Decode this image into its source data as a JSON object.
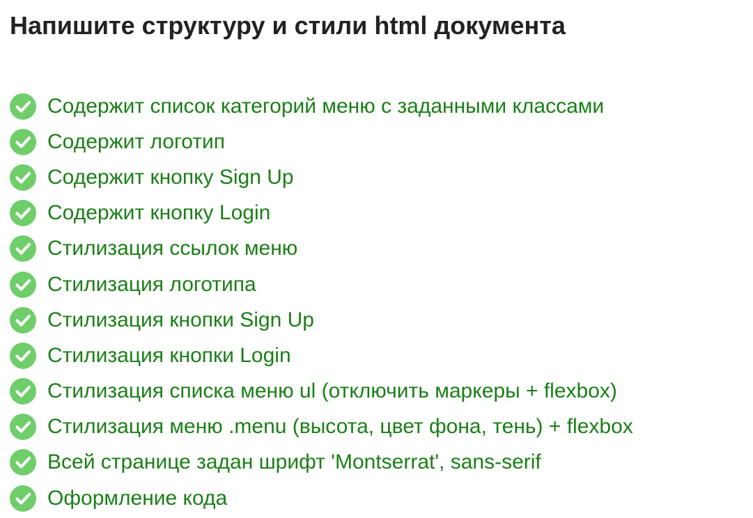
{
  "page": {
    "title": "Напишите структуру и стили html документа"
  },
  "checklist": {
    "icon": "check-circle-icon",
    "icon_color": "#6fce6a",
    "text_color": "#1a7f16",
    "items": [
      {
        "label": "Содержит список категорий меню с заданными классами",
        "checked": true
      },
      {
        "label": "Содержит логотип",
        "checked": true
      },
      {
        "label": "Содержит кнопку Sign Up",
        "checked": true
      },
      {
        "label": "Содержит кнопку Login",
        "checked": true
      },
      {
        "label": "Стилизация ссылок меню",
        "checked": true
      },
      {
        "label": "Стилизация логотипа",
        "checked": true
      },
      {
        "label": "Стилизация кнопки Sign Up",
        "checked": true
      },
      {
        "label": "Стилизация кнопки Login",
        "checked": true
      },
      {
        "label": "Стилизация списка меню ul (отключить маркеры + flexbox)",
        "checked": true
      },
      {
        "label": "Стилизация меню .menu (высота, цвет фона, тень) + flexbox",
        "checked": true
      },
      {
        "label": "Всей странице задан шрифт 'Montserrat', sans-serif",
        "checked": true
      },
      {
        "label": "Оформление кода",
        "checked": true
      }
    ]
  }
}
